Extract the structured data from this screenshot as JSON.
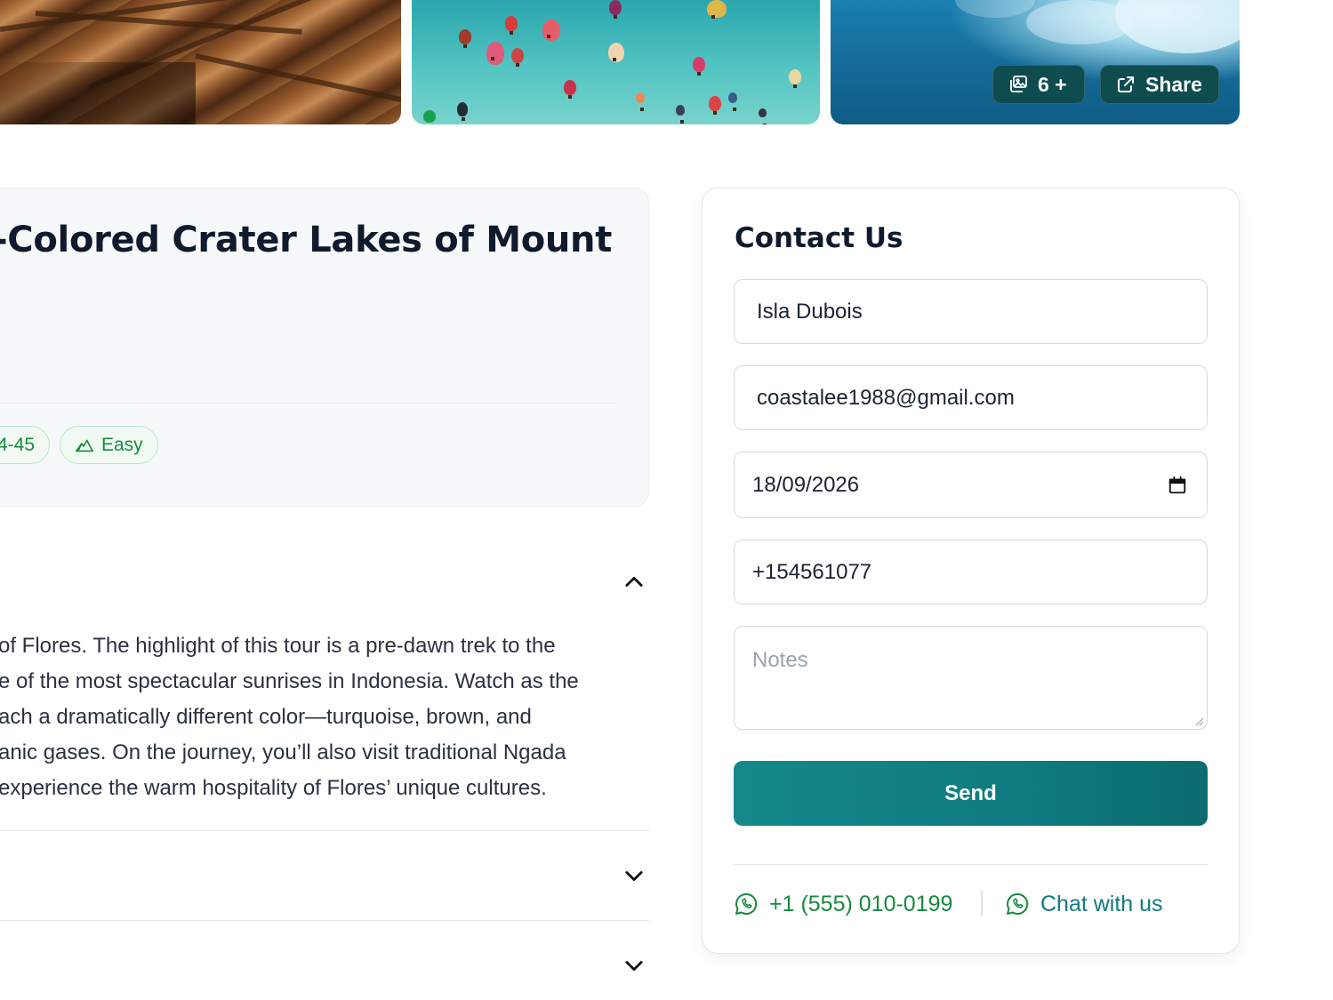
{
  "gallery": {
    "photo_count_label": "6 +",
    "share_label": "Share"
  },
  "tour": {
    "title": "-Colored Crater Lakes of Mount",
    "chips": {
      "age": "4-45",
      "difficulty": "Easy"
    },
    "description_lines": [
      "of Flores. The highlight of this tour is a pre-dawn trek to the",
      "e of the most spectacular sunrises in Indonesia. Watch as the",
      "ach a dramatically different color—turquoise, brown, and",
      "anic gases. On the journey, you’ll also visit traditional Ngada",
      "experience the warm hospitality of Flores’ unique cultures."
    ]
  },
  "contact": {
    "title": "Contact Us",
    "name_value": "Isla Dubois",
    "email_value": "coastalee1988@gmail.com",
    "date_value": "18/09/2026",
    "phone_value": "+154561077",
    "notes_placeholder": "Notes",
    "send_label": "Send",
    "phone_link": "+1 (555) 010-0199",
    "chat_link": "Chat with us"
  },
  "colors": {
    "accent_teal": "#0f7b80",
    "success_green": "#178a3e",
    "title_dark": "#0f1b2d"
  }
}
